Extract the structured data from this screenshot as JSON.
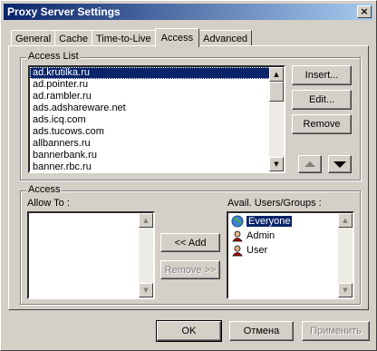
{
  "window": {
    "title": "Proxy Server Settings",
    "close_glyph": "×"
  },
  "tabs": [
    {
      "label": "General"
    },
    {
      "label": "Cache"
    },
    {
      "label": "Time-to-Live"
    },
    {
      "label": "Access",
      "active": true
    },
    {
      "label": "Advanced"
    }
  ],
  "access_list": {
    "group_label": "Access List",
    "items": [
      "ad.krutilka.ru",
      "ad.pointer.ru",
      "ad.rambler.ru",
      "ads.adshareware.net",
      "ads.icq.com",
      "ads.tucows.com",
      "allbanners.ru",
      "bannerbank.ru",
      "banner.rbc.ru"
    ],
    "selected_index": 0,
    "buttons": {
      "insert": "Insert...",
      "edit": "Edit...",
      "remove": "Remove"
    }
  },
  "access": {
    "group_label": "Access",
    "allow_to_label": "Allow To :",
    "avail_label": "Avail. Users/Groups :",
    "add_button": "<< Add",
    "remove_button": "Remove >>",
    "users": [
      {
        "label": "Everyone",
        "icon": "globe-icon",
        "selected": true
      },
      {
        "label": "Admin",
        "icon": "user-icon"
      },
      {
        "label": "User",
        "icon": "user-icon"
      }
    ]
  },
  "footer": {
    "ok": "OK",
    "cancel": "Отмена",
    "apply": "Применить"
  }
}
